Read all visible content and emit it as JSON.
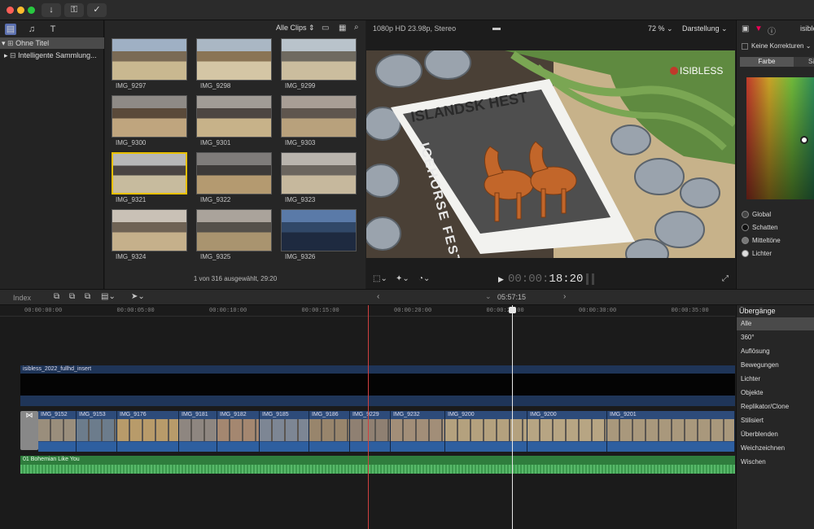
{
  "toolbar": {
    "import_icon": "download-arrow",
    "keys_icon": "key",
    "check_icon": "checkmark"
  },
  "sidebar": {
    "library_title": "Ohne Titel",
    "items": [
      "Intelligente Sammlung..."
    ]
  },
  "browser": {
    "filter_label": "Alle Clips",
    "clips": [
      "IMG_9297",
      "IMG_9298",
      "IMG_9299",
      "IMG_9300",
      "IMG_9301",
      "IMG_9303",
      "IMG_9321",
      "IMG_9322",
      "IMG_9323",
      "IMG_9324",
      "IMG_9325",
      "IMG_9326"
    ],
    "selected_clip": "IMG_9321",
    "status": "1 von 316 ausgewählt, 29:20"
  },
  "viewer": {
    "format": "1080p HD 23.98p, Stereo",
    "zoom": "72 %",
    "display_menu": "Darstellung",
    "timecode_dim": "00:00:",
    "timecode": "18:20",
    "poster": {
      "title": "ISLANDSK HEST",
      "side_text": "ICEHORSE FESTIV",
      "watermark": "ISIBLESS"
    }
  },
  "inspector": {
    "top_label": "isible",
    "corrections_label": "Keine Korrekturen",
    "tab_color": "Farbe",
    "tab_second": "Sä",
    "ranges": [
      "Global",
      "Schatten",
      "Mitteltöne",
      "Lichter"
    ]
  },
  "timeline_bar": {
    "index_label": "Index",
    "duration": "05:57:15"
  },
  "ruler": [
    "00:00:00:00",
    "00:00:05:00",
    "00:00:10:00",
    "00:00:15:00",
    "00:00:20:00",
    "00:00:25:00",
    "00:00:30:00",
    "00:00:35:00"
  ],
  "tracks": {
    "insert_clip": "isibless_2022_fullhd_insert",
    "primary_clips": [
      "IMG_9152",
      "IMG_9153",
      "IMG_9176",
      "IMG_9181",
      "IMG_9182",
      "IMG_9185",
      "IMG_9186",
      "IMG_9229",
      "IMG_9232",
      "IMG_9200",
      "IMG_9200",
      "IMG_9201"
    ],
    "audio_clip": "01 Bohemian Like You"
  },
  "transitions": {
    "title": "Übergänge",
    "items": [
      "Alle",
      "360°",
      "Auflösung",
      "Bewegungen",
      "Lichter",
      "Objekte",
      "Replikator/Clone",
      "Stilisiert",
      "Überblenden",
      "Weichzeichnen",
      "Wischen"
    ],
    "selected": "Alle"
  },
  "colors": {
    "accent": "#e8c000",
    "clip_blue": "#2d4b7a",
    "audio_green": "#2f7d3d",
    "playhead": "#d04040"
  }
}
